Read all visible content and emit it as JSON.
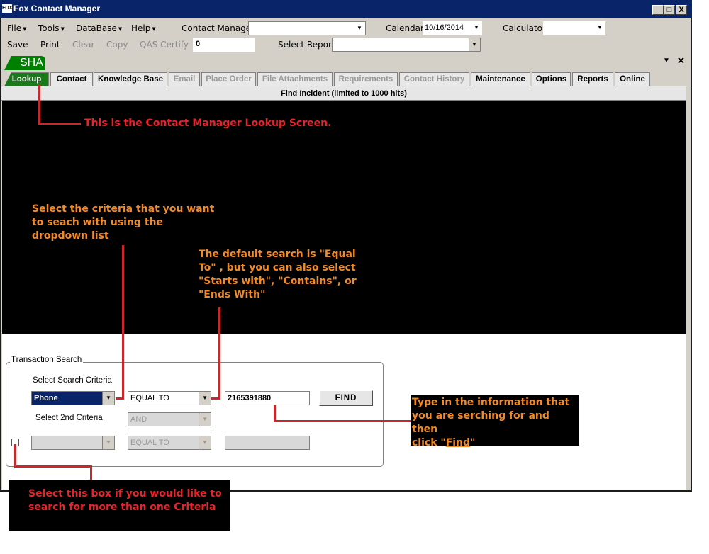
{
  "window": {
    "title": "Fox Contact Manager",
    "logo": "FOX",
    "min_icon": "_",
    "max_icon": "□",
    "close_icon": "X"
  },
  "menubar": {
    "items": [
      "File",
      "Tools",
      "DataBase",
      "Help"
    ],
    "contact_manager_label": "Contact Manager",
    "contact_manager_value": "",
    "calendar_label": "Calendar",
    "calendar_value": "10/16/2014",
    "calculator_label": "Calculator",
    "calculator_value": ""
  },
  "toolbar": {
    "save": "Save",
    "print": "Print",
    "clear": "Clear",
    "copy": "Copy",
    "qas_certify": "QAS Certify",
    "qas_value": "0",
    "select_report_label": "Select Report",
    "select_report_value": ""
  },
  "sha_tab": "SHA",
  "strip_icons": {
    "dropdown": "▼",
    "close": "✕"
  },
  "tabs": [
    {
      "label": "Lookup",
      "state": "active"
    },
    {
      "label": "Contact",
      "state": "enabled"
    },
    {
      "label": "Knowledge Base",
      "state": "enabled"
    },
    {
      "label": "Email",
      "state": "disabled"
    },
    {
      "label": "Place Order",
      "state": "disabled"
    },
    {
      "label": "File Attachments",
      "state": "disabled"
    },
    {
      "label": "Requirements",
      "state": "disabled"
    },
    {
      "label": "Contact History",
      "state": "disabled"
    },
    {
      "label": "Maintenance",
      "state": "enabled"
    },
    {
      "label": "Options",
      "state": "enabled"
    },
    {
      "label": "Reports",
      "state": "enabled"
    },
    {
      "label": "Online",
      "state": "enabled"
    }
  ],
  "find_bar": "Find Incident (limited to 1000 hits)",
  "transaction_search": {
    "group_label": "Transaction Search",
    "criteria_label": "Select Search Criteria",
    "criteria_value": "Phone",
    "operator_value": "EQUAL TO",
    "search_value": "2165391880",
    "find_label": "FIND",
    "second_criteria_label": "Select 2nd Criteria",
    "logic_value": "AND",
    "second_criteria_value": "",
    "second_operator_value": "EQUAL TO",
    "second_search_value": ""
  },
  "annotations": {
    "lookup_screen": "This is the Contact Manager Lookup Screen.",
    "criteria": [
      "Select the criteria that you want",
      "to seach with using the",
      "dropdown list"
    ],
    "default_search": [
      "The default search is \"Equal",
      "To\" , but you can also select",
      "\"Starts with\", \"Contains\", or",
      "\"Ends With\""
    ],
    "find_lines": [
      "Type in the information that",
      "you are serching for and then"
    ],
    "find_click": "click \"",
    "find_word": "Find",
    "find_end": "\"",
    "checkbox_note": [
      "Select this box if you would like to",
      "search for more than one Criteria"
    ]
  },
  "colors": {
    "title_bar": "#0a246a",
    "lookup_tab": "#1a7a1a",
    "note_red": "#e8242a",
    "note_orange": "#f08a2a"
  }
}
